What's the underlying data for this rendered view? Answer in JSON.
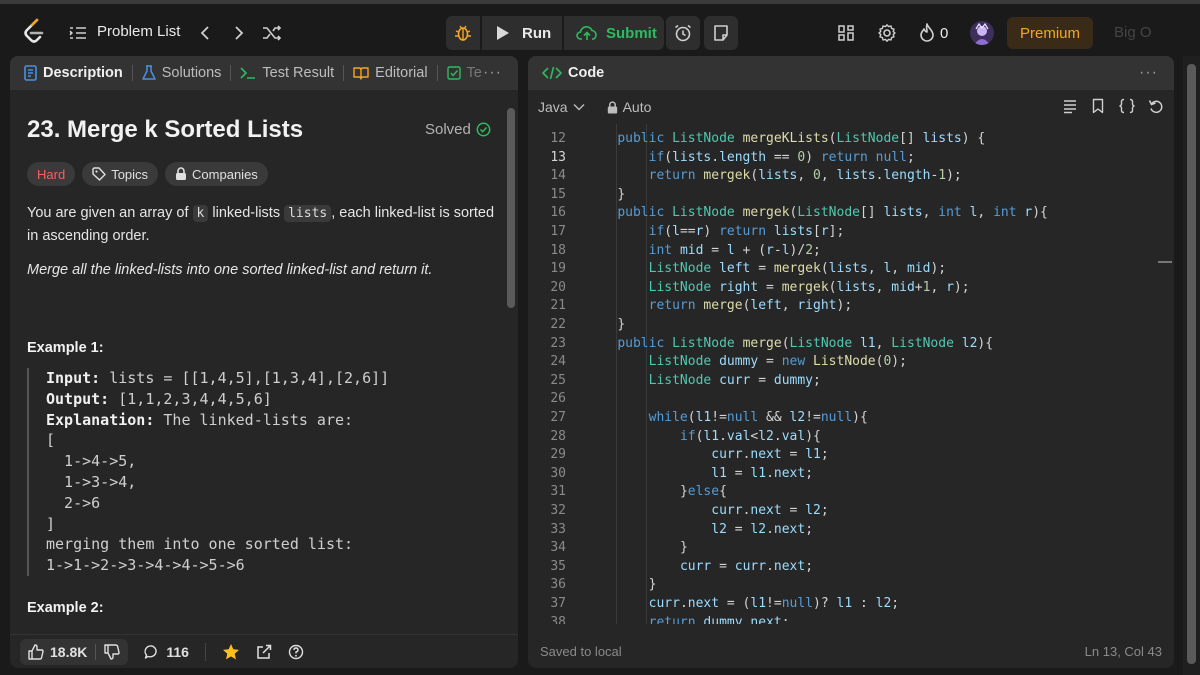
{
  "topbar": {
    "problem_list_label": "Problem List",
    "run_label": "Run",
    "submit_label": "Submit",
    "streak_count": "0",
    "premium_label": "Premium",
    "big_o_label": "Big O"
  },
  "left_tabs": [
    {
      "label": "Description",
      "active": true
    },
    {
      "label": "Solutions"
    },
    {
      "label": "Test Result"
    },
    {
      "label": "Editorial"
    },
    {
      "label": "Te"
    }
  ],
  "problem": {
    "title": "23. Merge k Sorted Lists",
    "status": "Solved",
    "difficulty": "Hard",
    "topics_label": "Topics",
    "companies_label": "Companies",
    "desc_part1": "You are given an array of ",
    "desc_code1": "k",
    "desc_part2": " linked-lists ",
    "desc_code2": "lists",
    "desc_part3": ", each linked-list is sorted in ascending order.",
    "desc_italic": "Merge all the linked-lists into one sorted linked-list and return it.",
    "example1_label": "Example 1:",
    "example1": {
      "input_label": "Input:",
      "input_value": " lists = [[1,4,5],[1,3,4],[2,6]]",
      "output_label": "Output:",
      "output_value": " [1,1,2,3,4,4,5,6]",
      "explanation_label": "Explanation:",
      "explanation_value": " The linked-lists are:",
      "lines": [
        "[",
        "  1->4->5,",
        "  1->3->4,",
        "  2->6",
        "]",
        "merging them into one sorted list:",
        "1->1->2->3->4->4->5->6"
      ]
    },
    "example2_label": "Example 2:"
  },
  "bottom_bar": {
    "likes": "18.8K",
    "comments": "116"
  },
  "code_panel": {
    "title": "Code",
    "language": "Java",
    "mode": "Auto",
    "status_left": "Saved to local",
    "status_right": "Ln 13, Col 43",
    "current_line": 13,
    "lines": [
      {
        "n": "12",
        "indent": 4,
        "tokens": [
          [
            "kw",
            "public "
          ],
          [
            "ty",
            "ListNode "
          ],
          [
            "fn",
            "mergeKLists"
          ],
          [
            "",
            "("
          ],
          [
            "ty",
            "ListNode"
          ],
          [
            "",
            "[] "
          ],
          [
            "vr",
            "lists"
          ],
          [
            "",
            ") {"
          ]
        ]
      },
      {
        "n": "13",
        "indent": 8,
        "tokens": [
          [
            "kw",
            "if"
          ],
          [
            "",
            "("
          ],
          [
            "vr",
            "lists"
          ],
          [
            "",
            "."
          ],
          [
            "vr",
            "length"
          ],
          [
            "",
            " == "
          ],
          [
            "nm",
            "0"
          ],
          [
            "",
            ") "
          ],
          [
            "kw",
            "return null"
          ],
          [
            "",
            ";"
          ]
        ]
      },
      {
        "n": "14",
        "indent": 8,
        "tokens": [
          [
            "kw",
            "return "
          ],
          [
            "fn",
            "mergek"
          ],
          [
            "",
            "("
          ],
          [
            "vr",
            "lists"
          ],
          [
            "",
            ", "
          ],
          [
            "nm",
            "0"
          ],
          [
            "",
            ", "
          ],
          [
            "vr",
            "lists"
          ],
          [
            "",
            "."
          ],
          [
            "vr",
            "length"
          ],
          [
            "",
            "-"
          ],
          [
            "nm",
            "1"
          ],
          [
            "",
            ");"
          ]
        ]
      },
      {
        "n": "15",
        "indent": 4,
        "tokens": [
          [
            "",
            "}"
          ]
        ]
      },
      {
        "n": "16",
        "indent": 4,
        "tokens": [
          [
            "kw",
            "public "
          ],
          [
            "ty",
            "ListNode "
          ],
          [
            "fn",
            "mergek"
          ],
          [
            "",
            "("
          ],
          [
            "ty",
            "ListNode"
          ],
          [
            "",
            "[] "
          ],
          [
            "vr",
            "lists"
          ],
          [
            "",
            ", "
          ],
          [
            "kw",
            "int "
          ],
          [
            "vr",
            "l"
          ],
          [
            "",
            ", "
          ],
          [
            "kw",
            "int "
          ],
          [
            "vr",
            "r"
          ],
          [
            "",
            "){"
          ]
        ]
      },
      {
        "n": "17",
        "indent": 8,
        "tokens": [
          [
            "kw",
            "if"
          ],
          [
            "",
            "("
          ],
          [
            "vr",
            "l"
          ],
          [
            "",
            "=="
          ],
          [
            "vr",
            "r"
          ],
          [
            "",
            ") "
          ],
          [
            "kw",
            "return "
          ],
          [
            "vr",
            "lists"
          ],
          [
            "",
            "["
          ],
          [
            "vr",
            "r"
          ],
          [
            "",
            "];"
          ]
        ]
      },
      {
        "n": "18",
        "indent": 8,
        "tokens": [
          [
            "kw",
            "int "
          ],
          [
            "vr",
            "mid"
          ],
          [
            "",
            " = "
          ],
          [
            "vr",
            "l"
          ],
          [
            "",
            " + ("
          ],
          [
            "vr",
            "r"
          ],
          [
            "",
            "-"
          ],
          [
            "vr",
            "l"
          ],
          [
            "",
            ")/"
          ],
          [
            "nm",
            "2"
          ],
          [
            "",
            ";"
          ]
        ]
      },
      {
        "n": "19",
        "indent": 8,
        "tokens": [
          [
            "ty",
            "ListNode "
          ],
          [
            "vr",
            "left"
          ],
          [
            "",
            " = "
          ],
          [
            "fn",
            "mergek"
          ],
          [
            "",
            "("
          ],
          [
            "vr",
            "lists"
          ],
          [
            "",
            ", "
          ],
          [
            "vr",
            "l"
          ],
          [
            "",
            ", "
          ],
          [
            "vr",
            "mid"
          ],
          [
            "",
            ");"
          ]
        ]
      },
      {
        "n": "20",
        "indent": 8,
        "tokens": [
          [
            "ty",
            "ListNode "
          ],
          [
            "vr",
            "right"
          ],
          [
            "",
            " = "
          ],
          [
            "fn",
            "mergek"
          ],
          [
            "",
            "("
          ],
          [
            "vr",
            "lists"
          ],
          [
            "",
            ", "
          ],
          [
            "vr",
            "mid"
          ],
          [
            "",
            "+"
          ],
          [
            "nm",
            "1"
          ],
          [
            "",
            ", "
          ],
          [
            "vr",
            "r"
          ],
          [
            "",
            ");"
          ]
        ]
      },
      {
        "n": "21",
        "indent": 8,
        "tokens": [
          [
            "kw",
            "return "
          ],
          [
            "fn",
            "merge"
          ],
          [
            "",
            "("
          ],
          [
            "vr",
            "left"
          ],
          [
            "",
            ", "
          ],
          [
            "vr",
            "right"
          ],
          [
            "",
            ");"
          ]
        ]
      },
      {
        "n": "22",
        "indent": 4,
        "tokens": [
          [
            "",
            "}"
          ]
        ]
      },
      {
        "n": "23",
        "indent": 4,
        "tokens": [
          [
            "kw",
            "public "
          ],
          [
            "ty",
            "ListNode "
          ],
          [
            "fn",
            "merge"
          ],
          [
            "",
            "("
          ],
          [
            "ty",
            "ListNode "
          ],
          [
            "vr",
            "l1"
          ],
          [
            "",
            ", "
          ],
          [
            "ty",
            "ListNode "
          ],
          [
            "vr",
            "l2"
          ],
          [
            "",
            "){"
          ]
        ]
      },
      {
        "n": "24",
        "indent": 8,
        "tokens": [
          [
            "ty",
            "ListNode "
          ],
          [
            "vr",
            "dummy"
          ],
          [
            "",
            " = "
          ],
          [
            "kw",
            "new "
          ],
          [
            "fn",
            "ListNode"
          ],
          [
            "",
            "("
          ],
          [
            "nm",
            "0"
          ],
          [
            "",
            ");"
          ]
        ]
      },
      {
        "n": "25",
        "indent": 8,
        "tokens": [
          [
            "ty",
            "ListNode "
          ],
          [
            "vr",
            "curr"
          ],
          [
            "",
            " = "
          ],
          [
            "vr",
            "dummy"
          ],
          [
            "",
            ";"
          ]
        ]
      },
      {
        "n": "26",
        "indent": 0,
        "tokens": []
      },
      {
        "n": "27",
        "indent": 8,
        "tokens": [
          [
            "kw",
            "while"
          ],
          [
            "",
            "("
          ],
          [
            "vr",
            "l1"
          ],
          [
            "",
            "!="
          ],
          [
            "kw",
            "null"
          ],
          [
            "",
            " && "
          ],
          [
            "vr",
            "l2"
          ],
          [
            "",
            "!="
          ],
          [
            "kw",
            "null"
          ],
          [
            "",
            "){"
          ]
        ]
      },
      {
        "n": "28",
        "indent": 12,
        "tokens": [
          [
            "kw",
            "if"
          ],
          [
            "",
            "("
          ],
          [
            "vr",
            "l1"
          ],
          [
            "",
            "."
          ],
          [
            "vr",
            "val"
          ],
          [
            "",
            "<"
          ],
          [
            "vr",
            "l2"
          ],
          [
            "",
            "."
          ],
          [
            "vr",
            "val"
          ],
          [
            "",
            "){"
          ]
        ]
      },
      {
        "n": "29",
        "indent": 16,
        "tokens": [
          [
            "vr",
            "curr"
          ],
          [
            "",
            "."
          ],
          [
            "vr",
            "next"
          ],
          [
            "",
            " = "
          ],
          [
            "vr",
            "l1"
          ],
          [
            "",
            ";"
          ]
        ]
      },
      {
        "n": "30",
        "indent": 16,
        "tokens": [
          [
            "vr",
            "l1"
          ],
          [
            "",
            " = "
          ],
          [
            "vr",
            "l1"
          ],
          [
            "",
            "."
          ],
          [
            "vr",
            "next"
          ],
          [
            "",
            ";"
          ]
        ]
      },
      {
        "n": "31",
        "indent": 12,
        "tokens": [
          [
            "",
            "}"
          ],
          [
            "kw",
            "else"
          ],
          [
            "",
            "{"
          ]
        ]
      },
      {
        "n": "32",
        "indent": 16,
        "tokens": [
          [
            "vr",
            "curr"
          ],
          [
            "",
            "."
          ],
          [
            "vr",
            "next"
          ],
          [
            "",
            " = "
          ],
          [
            "vr",
            "l2"
          ],
          [
            "",
            ";"
          ]
        ]
      },
      {
        "n": "33",
        "indent": 16,
        "tokens": [
          [
            "vr",
            "l2"
          ],
          [
            "",
            " = "
          ],
          [
            "vr",
            "l2"
          ],
          [
            "",
            "."
          ],
          [
            "vr",
            "next"
          ],
          [
            "",
            ";"
          ]
        ]
      },
      {
        "n": "34",
        "indent": 12,
        "tokens": [
          [
            "",
            "}"
          ]
        ]
      },
      {
        "n": "35",
        "indent": 12,
        "tokens": [
          [
            "vr",
            "curr"
          ],
          [
            "",
            " = "
          ],
          [
            "vr",
            "curr"
          ],
          [
            "",
            "."
          ],
          [
            "vr",
            "next"
          ],
          [
            "",
            ";"
          ]
        ]
      },
      {
        "n": "36",
        "indent": 8,
        "tokens": [
          [
            "",
            "}"
          ]
        ]
      },
      {
        "n": "37",
        "indent": 8,
        "tokens": [
          [
            "vr",
            "curr"
          ],
          [
            "",
            "."
          ],
          [
            "vr",
            "next"
          ],
          [
            "",
            " = ("
          ],
          [
            "vr",
            "l1"
          ],
          [
            "",
            "!="
          ],
          [
            "kw",
            "null"
          ],
          [
            "",
            ")? "
          ],
          [
            "vr",
            "l1"
          ],
          [
            "",
            " : "
          ],
          [
            "vr",
            "l2"
          ],
          [
            "",
            ";"
          ]
        ]
      },
      {
        "n": "38",
        "indent": 8,
        "tokens": [
          [
            "kw",
            "return "
          ],
          [
            "vr",
            "dummy"
          ],
          [
            "",
            "."
          ],
          [
            "vr",
            "next"
          ],
          [
            "",
            ";"
          ]
        ]
      }
    ]
  },
  "colors": {
    "accent_green": "#2cbb5d",
    "hard_red": "#f8615c",
    "premium_orange": "#f5a623",
    "star_yellow": "#ffc01e"
  }
}
